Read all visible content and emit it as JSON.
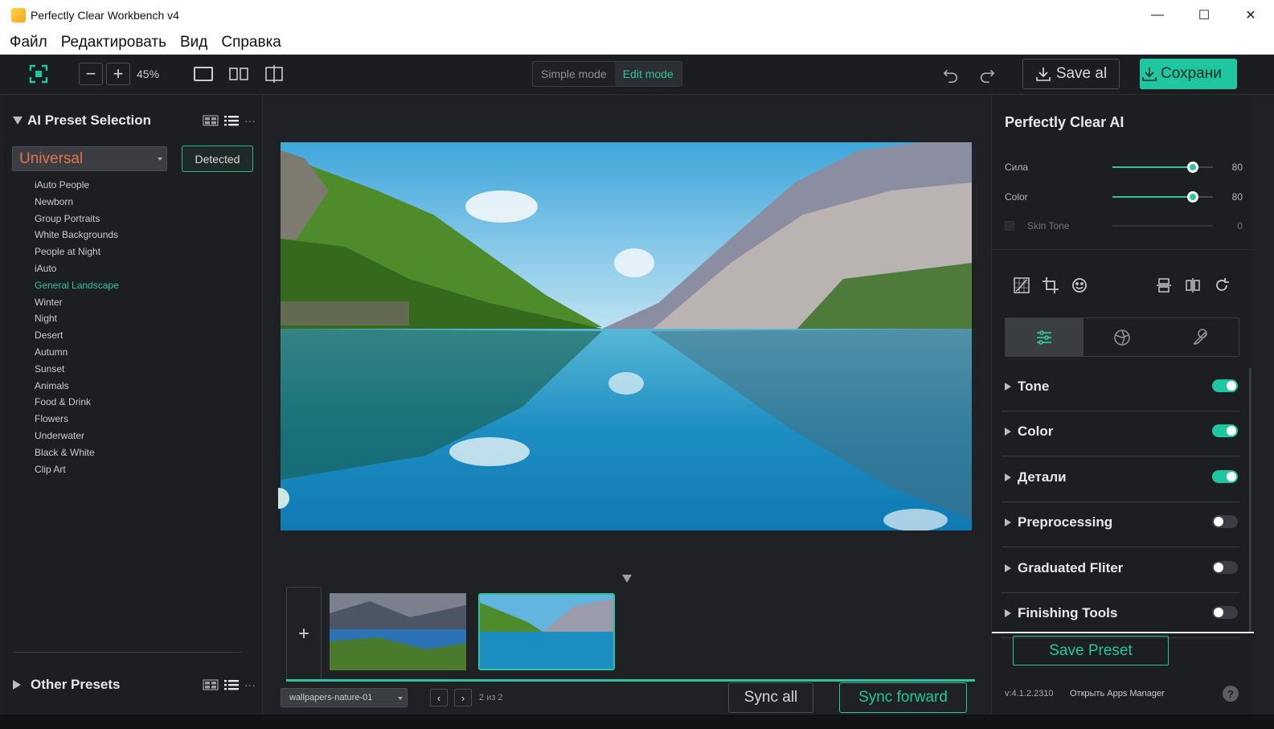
{
  "window": {
    "title": "Perfectly Clear Workbench v4",
    "controls": [
      "—",
      "☐",
      "✕"
    ]
  },
  "menu": [
    "Файл",
    "Редактировать",
    "Вид",
    "Справка"
  ],
  "toolbar": {
    "zoom": "45%",
    "zoom_out": "−",
    "zoom_in": "+",
    "mode_simple": "Simple mode",
    "mode_edit": "Edit mode",
    "active_mode": "Edit mode",
    "save_all": "Save al",
    "save": "Сохрани",
    "accent": "#1ec7a0"
  },
  "left_panel": {
    "title": "AI Preset Selection",
    "dropdown_value": "Universal",
    "detected_button": "Detected",
    "presets": [
      "iAuto People",
      "Newborn",
      "Group Portraits",
      "White Backgrounds",
      "People at Night",
      "iAuto",
      "General Landscape",
      "Winter",
      "Night",
      "Desert",
      "Autumn",
      "Sunset",
      "Animals",
      "Food & Drink",
      "Flowers",
      "Underwater",
      "Black & White",
      "Clip Art"
    ],
    "active_preset": "General Landscape",
    "other_presets": "Other Presets",
    "more": "···"
  },
  "filmstrip": {
    "add": "+",
    "file_select": "wallpapers-nature-01",
    "prev": "‹",
    "next": "›",
    "counter": "2 из 2",
    "sync_all": "Sync all",
    "sync_forward": "Sync forward"
  },
  "right_panel": {
    "title": "Perfectly Clear AI",
    "sliders": [
      {
        "label": "Сила",
        "value": "80",
        "level": 0.8,
        "enabled": true
      },
      {
        "label": "Color",
        "value": "80",
        "level": 0.8,
        "enabled": true
      },
      {
        "label": "Skin Tone",
        "value": "0",
        "level": 0,
        "enabled": false
      }
    ],
    "sections": [
      {
        "label": "Tone",
        "on": true
      },
      {
        "label": "Color",
        "on": true
      },
      {
        "label": "Детали",
        "on": true
      },
      {
        "label": "Preprocessing",
        "on": false
      },
      {
        "label": "Graduated Fliter",
        "on": false
      },
      {
        "label": "Finishing Tools",
        "on": false
      }
    ],
    "save_preset": "Save Preset",
    "version": "v:4.1.2.2310",
    "apps_link": "Открыть Apps Manager",
    "help": "?"
  }
}
